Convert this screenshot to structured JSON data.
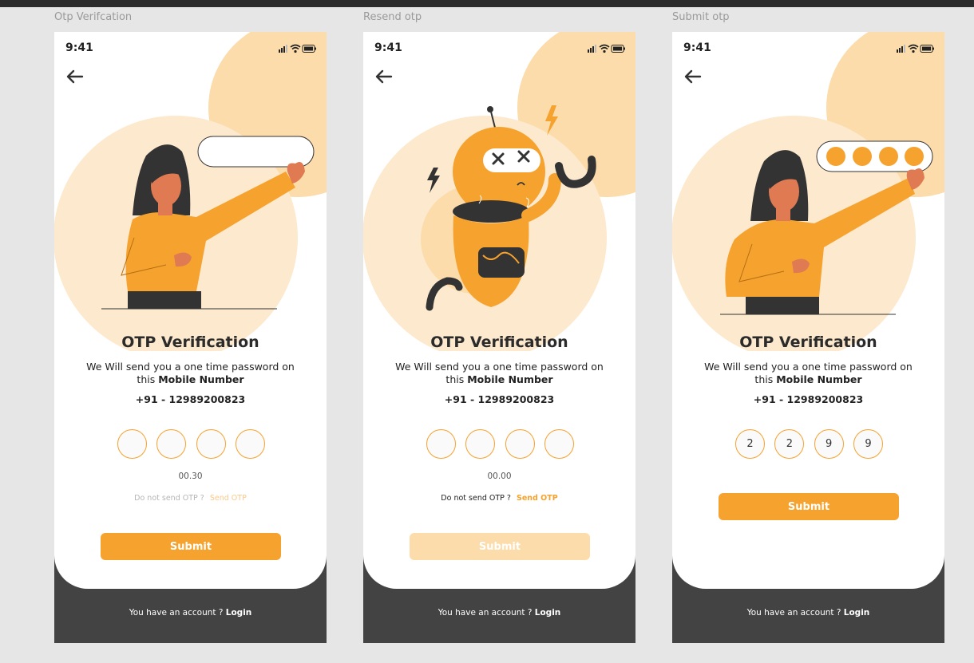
{
  "frames": [
    {
      "title": "Otp Verifcation",
      "time": "9:41",
      "heading": "OTP Verification",
      "desc_text": "We Will send you a one time password on this",
      "desc_bold": "Mobile Number",
      "phone": "+91 - 12989200823",
      "digits": [
        "",
        "",
        "",
        ""
      ],
      "timer": "00.30",
      "resend_text": "Do not send OTP  ?",
      "resend_link": "Send OTP",
      "submit": "Submit",
      "footer_text": "You  have an account ?",
      "footer_link": "Login"
    },
    {
      "title": "Resend otp",
      "time": "9:41",
      "heading": "OTP Verification",
      "desc_text": "We Will send you a one time password on this",
      "desc_bold": "Mobile Number",
      "phone": "+91 - 12989200823",
      "digits": [
        "",
        "",
        "",
        ""
      ],
      "timer": "00.00",
      "resend_text": "Do not send OTP  ?",
      "resend_link": "Send OTP",
      "submit": "Submit",
      "footer_text": "You  have an account ?",
      "footer_link": "Login"
    },
    {
      "title": "Submit otp",
      "time": "9:41",
      "heading": "OTP Verification",
      "desc_text": "We Will send you a one time password on this",
      "desc_bold": "Mobile Number",
      "phone": "+91 - 12989200823",
      "digits": [
        "2",
        "2",
        "9",
        "9"
      ],
      "submit": "Submit",
      "footer_text": "You  have an account ?",
      "footer_link": "Login"
    }
  ],
  "colors": {
    "accent": "#f6a22e",
    "accent_light": "#fcdcaa",
    "accent_pale": "#fde9cd",
    "dark": "#434343",
    "link_disabled": "#fcc98a"
  },
  "icons": {
    "back": "arrow-left-icon",
    "signal": "signal-icon",
    "wifi": "wifi-icon",
    "battery": "battery-icon"
  }
}
